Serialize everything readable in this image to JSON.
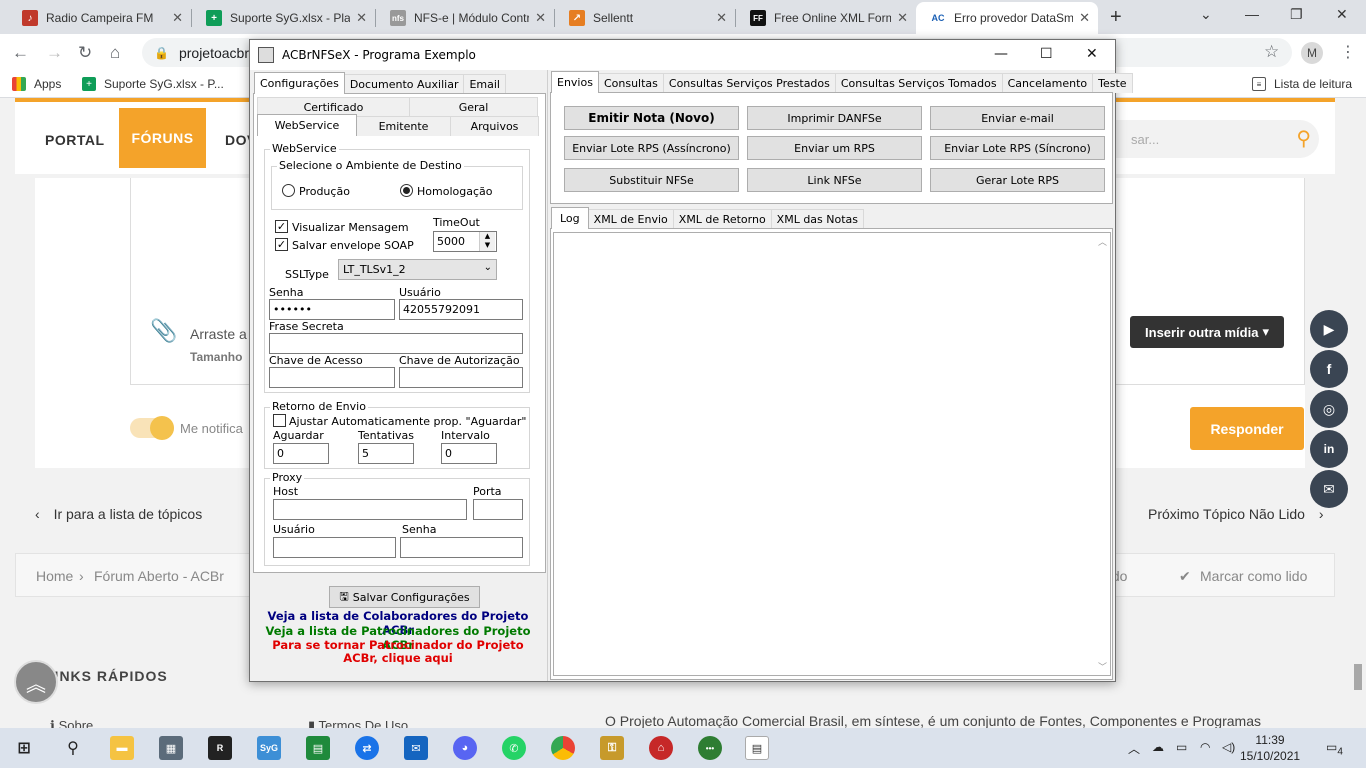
{
  "browser": {
    "tabs": [
      {
        "title": "Radio Campeira FM",
        "icon": "radio-favicon-icon"
      },
      {
        "title": "Suporte SyG.xlsx - Pla",
        "icon": "sheets-favicon-icon"
      },
      {
        "title": "NFS-e | Módulo Contr",
        "icon": "nfs-favicon-icon"
      },
      {
        "title": "Sellentt",
        "icon": "sellentt-favicon-icon"
      },
      {
        "title": "Free Online XML Form",
        "icon": "ff-favicon-icon"
      },
      {
        "title": "Erro provedor DataSm",
        "icon": "acbr-favicon-icon"
      }
    ],
    "url": "projetoacbr.",
    "profile_initial": "M",
    "bookmarks": {
      "apps": "Apps",
      "suporte": "Suporte SyG.xlsx - P...",
      "reading_list": "Lista de leitura"
    }
  },
  "site": {
    "nav": [
      "PORTAL",
      "FÓRUNS",
      "DOV"
    ],
    "search_placeholder": "sar...",
    "drop_title": "Arraste a",
    "drop_size": "Tamanho",
    "insert_media": "Inserir outra mídia",
    "notify_label": "Me notifica",
    "reply": "Responder",
    "prev_topic": "Ir para a lista de tópicos",
    "next_topic": "Próximo Tópico Não Lido",
    "breadcrumb": [
      "Home",
      "Fórum Aberto - ACBr"
    ],
    "crumb_right": [
      "Lido",
      "Marcar como lido"
    ],
    "footer_heading": "LINKS RÁPIDOS",
    "footer_links": [
      "Sobre",
      "Termos De Uso"
    ],
    "footer_text": "O Projeto Automação Comercial Brasil, em síntese, é um conjunto de Fontes, Componentes e Programas",
    "social": [
      "youtube-icon",
      "facebook-icon",
      "instagram-icon",
      "linkedin-icon",
      "mail-icon"
    ]
  },
  "dialog": {
    "title": "ACBrNFSeX - Programa Exemplo",
    "left_tabs": [
      "Configurações",
      "Documento Auxiliar",
      "Email"
    ],
    "sub_tabs_top": [
      "Certificado",
      "Geral"
    ],
    "sub_tabs_bottom": [
      "WebService",
      "Emitente",
      "Arquivos"
    ],
    "webservice_group": "WebService",
    "ambiente_group": "Selecione o Ambiente de Destino",
    "producao": "Produção",
    "homologacao": "Homologação",
    "ambiente_selected": "Homologação",
    "visualizar_msg": "Visualizar Mensagem",
    "salvar_envelope": "Salvar envelope SOAP",
    "timeout_label": "TimeOut",
    "timeout_value": "5000",
    "ssltype_label": "SSLType",
    "ssltype_value": "LT_TLSv1_2",
    "senha_label": "Senha",
    "senha_value": "••••••",
    "usuario_label": "Usuário",
    "usuario_value": "42055792091",
    "frase_label": "Frase Secreta",
    "chave_acesso_label": "Chave de Acesso",
    "chave_autorizacao_label": "Chave de Autorização",
    "retorno_group": "Retorno de Envio",
    "ajustar_label": "Ajustar Automaticamente prop. \"Aguardar\"",
    "aguardar_label": "Aguardar",
    "aguardar_value": "0",
    "tentativas_label": "Tentativas",
    "tentativas_value": "5",
    "intervalo_label": "Intervalo",
    "intervalo_value": "0",
    "proxy_group": "Proxy",
    "host_label": "Host",
    "porta_label": "Porta",
    "proxy_usuario_label": "Usuário",
    "proxy_senha_label": "Senha",
    "salvar_btn": "Salvar Configurações",
    "link_colaboradores": "Veja a lista de Colaboradores do Projeto ACBr",
    "link_patrocinadores": "Veja a lista de Patrocinadores do Projeto ACBr",
    "link_patrocinar": "Para se tornar Patrocinador do Projeto ACBr, clique aqui",
    "right_tabs": [
      "Envios",
      "Consultas",
      "Consultas Serviços Prestados",
      "Consultas Serviços Tomados",
      "Cancelamento",
      "Teste"
    ],
    "buttons": [
      "Emitir Nota (Novo)",
      "Imprimir DANFSe",
      "Enviar e-mail",
      "Enviar Lote RPS (Assíncrono)",
      "Enviar um RPS",
      "Enviar Lote RPS (Síncrono)",
      "Substituir NFSe",
      "Link NFSe",
      "Gerar Lote RPS"
    ],
    "log_tabs": [
      "Log",
      "XML de Envio",
      "XML de Retorno",
      "XML das Notas"
    ],
    "colors": {
      "navy": "#000080",
      "green": "#007a00",
      "red": "#e00000"
    }
  },
  "taskbar": {
    "time": "11:39",
    "date": "15/10/2021",
    "notifications": "4"
  }
}
